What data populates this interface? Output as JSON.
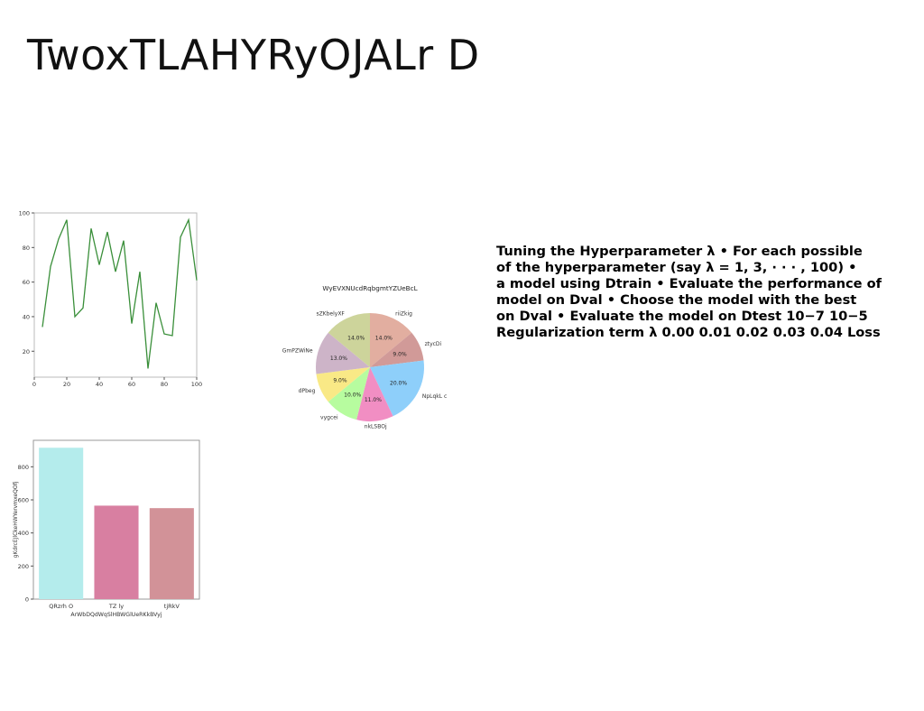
{
  "slide": {
    "title": "TwoxTLAHYRyOJALr D",
    "body_text": "Tuning the Hyperparameter λ • For each possible\nof the hyperparameter (say λ = 1, 3, · · · , 100) •\na model using Dtrain • Evaluate the performance of\nmodel on Dval • Choose the model with the best\non Dval • Evaluate the model on Dtest 10−7 10−5\nRegularization term λ 0.00 0.01 0.02 0.03 0.04 Loss"
  },
  "chart_data": [
    {
      "type": "line",
      "title": "",
      "xlabel": "",
      "ylabel": "",
      "x": [
        5,
        10,
        15,
        20,
        25,
        30,
        35,
        40,
        45,
        50,
        55,
        60,
        65,
        70,
        75,
        80,
        85,
        90,
        95,
        100
      ],
      "series": [
        {
          "values": [
            34,
            69,
            85,
            96,
            40,
            45,
            91,
            70,
            89,
            66,
            84,
            36,
            66,
            10,
            48,
            30,
            29,
            86,
            96,
            61
          ],
          "color": "#3a8f3a"
        }
      ],
      "xlim": [
        0,
        100
      ],
      "ylim": [
        5,
        100
      ],
      "xticks": [
        0,
        20,
        40,
        60,
        80,
        100
      ],
      "yticks": [
        20,
        40,
        60,
        80,
        100
      ],
      "grid": false
    },
    {
      "type": "pie",
      "title": "WyEVXNUcdRqbgmtYZUeBcL",
      "labels": [
        "riiZkig",
        "ztycDi",
        "NpLqkL c",
        "nkLSBOj",
        "vygcei",
        "dPbeg",
        "GmPZWiNe",
        "sZKbelyXF"
      ],
      "values": [
        14.0,
        9.0,
        20.0,
        11.0,
        10.0,
        9.0,
        13.0,
        14.0
      ],
      "value_labels": [
        "14.0%",
        "9.0%",
        "20.0%",
        "11.0%",
        "10.0%",
        "9.0%",
        "13.0%",
        "14.0%"
      ],
      "colors": [
        "#e2aea0",
        "#d19a98",
        "#8ecffa",
        "#f18ec3",
        "#b7fc9f",
        "#f9e986",
        "#cdb4c8",
        "#cdd49b"
      ]
    },
    {
      "type": "bar",
      "title": "",
      "categories": [
        "QRzrh O",
        "TZ ly",
        "tjRkV"
      ],
      "values": [
        915,
        565,
        550
      ],
      "colors": [
        "#b4ecec",
        "#d87fa1",
        "#d29298"
      ],
      "xlabel": "ArWbDQdWqSlHBWGlUeRKkBVyj",
      "ylabel": "gKdrcEJlCkeHWYervmxeQOfj",
      "ylim": [
        0,
        960
      ],
      "yticks": [
        0,
        200,
        400,
        600,
        800
      ],
      "grid": false
    }
  ]
}
